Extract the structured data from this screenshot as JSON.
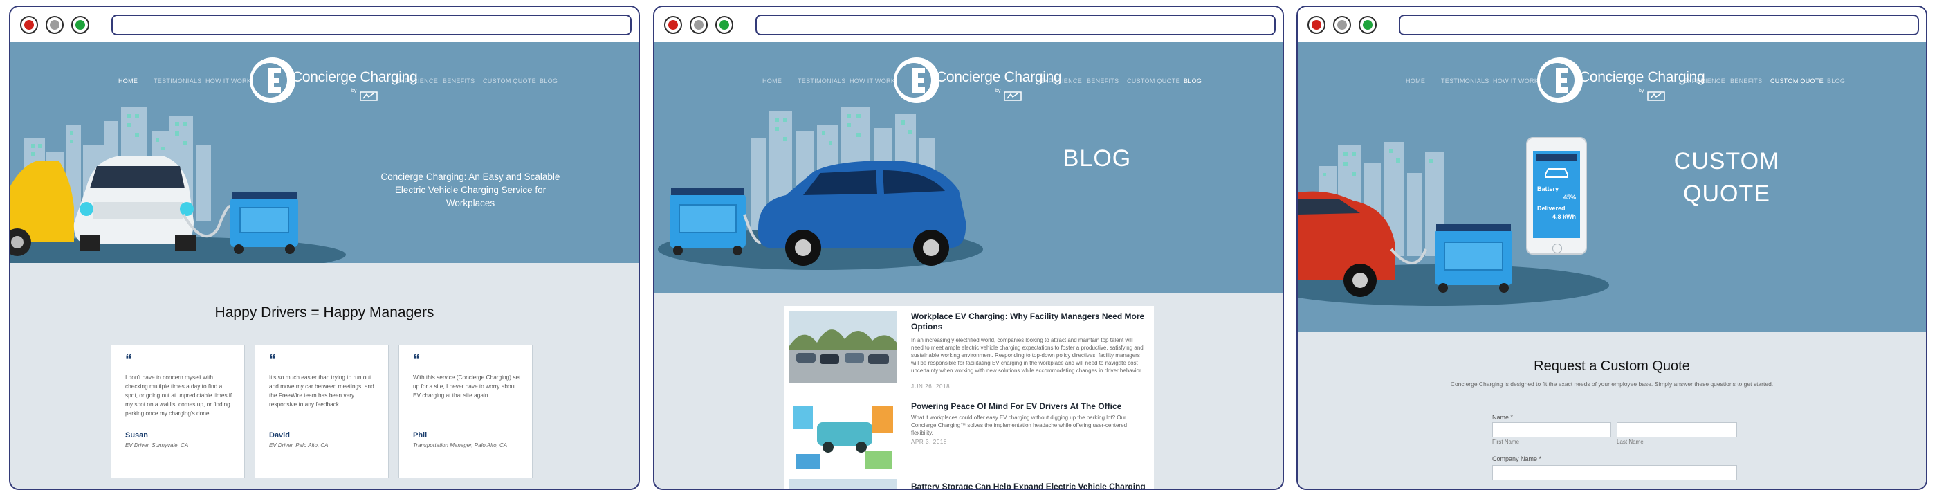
{
  "brand": {
    "name": "Concierge Charging",
    "by": "by"
  },
  "windows": [
    {
      "nav": [
        {
          "label": "HOME",
          "active": true
        },
        {
          "label": "TESTIMONIALS",
          "active": false
        },
        {
          "label": "HOW IT WORKS",
          "active": false
        },
        {
          "label": "EXPERIENCE",
          "active": false
        },
        {
          "label": "BENEFITS",
          "active": false
        },
        {
          "label": "CUSTOM QUOTE",
          "active": false
        },
        {
          "label": "BLOG",
          "active": false
        }
      ],
      "hero_tagline": "Concierge Charging: An Easy and Scalable Electric Vehicle Charging Service for Workplaces",
      "section_title": "Happy Drivers = Happy Managers",
      "testimonials": [
        {
          "quote_mark": "“",
          "text": "I don't have to concern myself with checking multiple times a day to find a spot, or going out at unpredictable times if my spot on a waitlist comes up, or finding parking once my charging's done.",
          "name": "Susan",
          "role": "EV Driver, Sunnyvale, CA"
        },
        {
          "quote_mark": "“",
          "text": "It's so much easier than trying to run out and move my car between meetings, and the FreeWire team has been very responsive to any feedback.",
          "name": "David",
          "role": "EV Driver, Palo Alto, CA"
        },
        {
          "quote_mark": "“",
          "text": "With this service (Concierge Charging) set up for a site, I never have to worry about EV charging at that site again.",
          "name": "Phil",
          "role": "Transportation Manager, Palo Alto, CA"
        }
      ]
    },
    {
      "nav": [
        {
          "label": "HOME",
          "active": false
        },
        {
          "label": "TESTIMONIALS",
          "active": false
        },
        {
          "label": "HOW IT WORKS",
          "active": false
        },
        {
          "label": "EXPERIENCE",
          "active": false
        },
        {
          "label": "BENEFITS",
          "active": false
        },
        {
          "label": "CUSTOM QUOTE",
          "active": false
        },
        {
          "label": "BLOG",
          "active": true
        }
      ],
      "hero_title": "BLOG",
      "posts": [
        {
          "title": "Workplace EV Charging: Why Facility Managers Need More Options",
          "excerpt": "In an increasingly electrified world, companies looking to attract and maintain top talent will need to meet ample electric vehicle charging expectations to foster a productive, satisfying and sustainable working environment. Responding to top-down policy directives, facility managers will be responsible for facilitating EV charging in the workplace and will need to navigate cost uncertainty when working with new solutions while accommodating changes in driver behavior.",
          "date": "JUN 26, 2018"
        },
        {
          "title": "Powering Peace Of Mind For EV Drivers At The Office",
          "excerpt": "What if workplaces could offer easy EV charging without digging up the parking lot? Our Concierge Charging™ solves the implementation headache while offering user-centered flexibility.",
          "date": "APR 3, 2018"
        },
        {
          "title": "Battery Storage Can Help Expand Electric Vehicle Charging",
          "excerpt": "",
          "date": ""
        }
      ]
    },
    {
      "nav": [
        {
          "label": "HOME",
          "active": false
        },
        {
          "label": "TESTIMONIALS",
          "active": false
        },
        {
          "label": "HOW IT WORKS",
          "active": false
        },
        {
          "label": "EXPERIENCE",
          "active": false
        },
        {
          "label": "BENEFITS",
          "active": false
        },
        {
          "label": "CUSTOM QUOTE",
          "active": true
        },
        {
          "label": "BLOG",
          "active": false
        }
      ],
      "hero_title_line1": "CUSTOM",
      "hero_title_line2": "QUOTE",
      "phone": {
        "battery_label": "Battery",
        "battery_value": "45%",
        "delivered_label": "Delivered",
        "delivered_value": "4.8 kWh"
      },
      "section_title": "Request a Custom Quote",
      "intro": "Concierge Charging is designed to fit the exact needs of your employee base. Simply answer these questions to get started.",
      "form": {
        "name_label": "Name *",
        "first_name": "First Name",
        "last_name": "Last Name",
        "company_label": "Company Name *"
      }
    }
  ],
  "colors": {
    "hero": "#6d9bb8",
    "lower": "#e0e6eb",
    "accent": "#1c3f6e",
    "frame": "#333a78"
  }
}
